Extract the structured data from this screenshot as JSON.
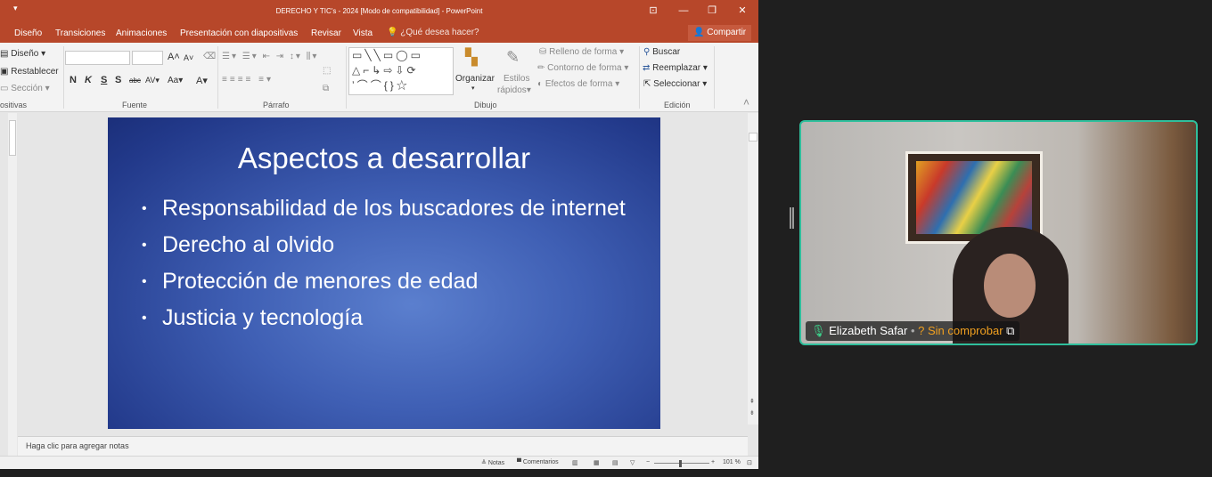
{
  "titlebar": {
    "qat_icon": "save-icon",
    "title": "DERECHO Y TIC's - 2024 [Modo de compatibilidad] - PowerPoint",
    "buttons": [
      "restore-ribbon-icon",
      "minimize-icon",
      "maximize-icon",
      "close-icon"
    ]
  },
  "tabs": {
    "items": [
      "Diseño",
      "Transiciones",
      "Animaciones",
      "Presentación con diapositivas",
      "Revisar",
      "Vista"
    ],
    "tell_me": "¿Qué desea hacer?",
    "share": "Compartir"
  },
  "ribbon": {
    "slides": {
      "layout": "Diseño",
      "reset": "Restablecer",
      "section": "Sección",
      "group": "ositivas"
    },
    "font": {
      "bold": "N",
      "italic": "K",
      "underline": "S",
      "shadow": "S",
      "strike": "abc",
      "spacing": "AV",
      "case": "Aa",
      "color": "A",
      "grow": "A",
      "shrink": "A",
      "group": "Fuente"
    },
    "paragraph": {
      "group": "Párrafo"
    },
    "drawing": {
      "arrange": "Organizar",
      "quick_styles_1": "Estilos",
      "quick_styles_2": "rápidos",
      "fill": "Relleno de forma",
      "outline": "Contorno de forma",
      "effects": "Efectos de forma",
      "group": "Dibujo",
      "shape_icons": [
        "▭",
        "╲",
        "╲",
        "▭",
        "◯",
        "▭",
        "△",
        "⌐",
        "↳",
        "⇨",
        "⇩",
        "⟳",
        "ʼ",
        "⌒",
        "⌒",
        "{",
        "}",
        "☆"
      ]
    },
    "editing": {
      "find": "Buscar",
      "replace": "Reemplazar",
      "select": "Seleccionar",
      "group": "Edición"
    }
  },
  "slide": {
    "title": "Aspectos a desarrollar",
    "bullets": [
      "Responsabilidad de los buscadores de internet",
      "Derecho al olvido",
      "Protección de menores de edad",
      "Justicia y tecnología"
    ]
  },
  "notes": {
    "placeholder": "Haga clic para agregar notas"
  },
  "status": {
    "notes": "Notas",
    "comments": "Comentarios",
    "zoom": "101 %"
  },
  "video": {
    "name": "Elizabeth Safar",
    "status": "Sin comprobar",
    "mic_icon": "mic-icon",
    "warn_icon": "question-circle-icon",
    "share_icon": "screen-share-icon"
  },
  "colors": {
    "accent": "#b7472a",
    "tile_border": "#2fbf9c",
    "warn": "#f0a020"
  }
}
